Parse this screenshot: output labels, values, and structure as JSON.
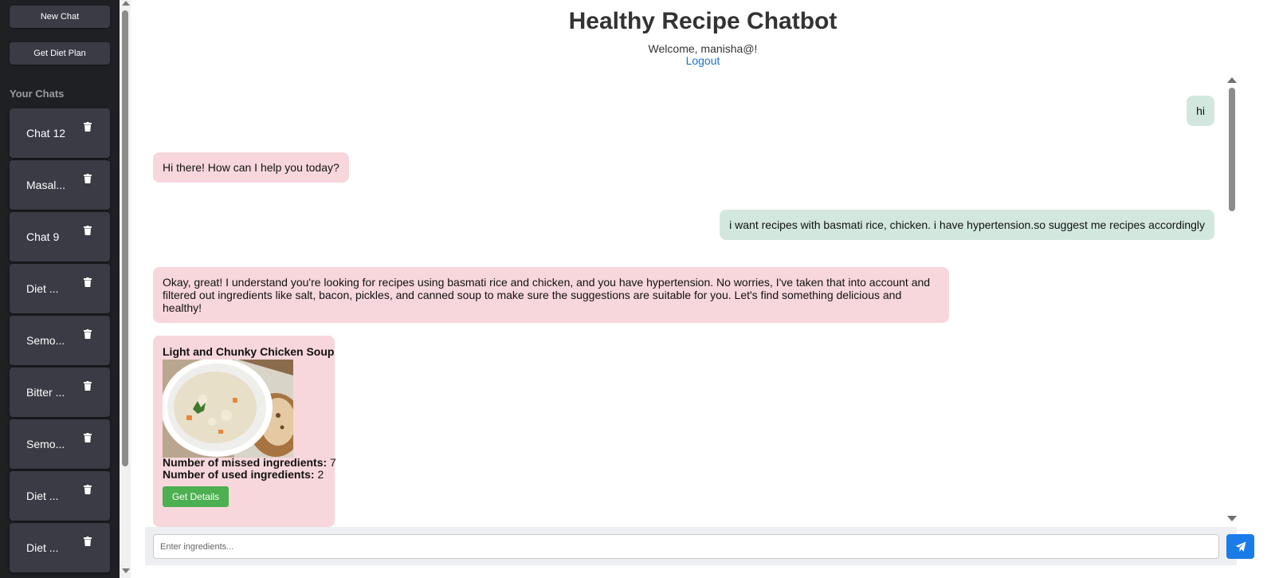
{
  "sidebar": {
    "new_chat_label": "New Chat",
    "diet_plan_label": "Get Diet Plan",
    "section_title": "Your Chats",
    "chats": [
      {
        "label": "Chat 12"
      },
      {
        "label": "Masal..."
      },
      {
        "label": "Chat 9"
      },
      {
        "label": "Diet ..."
      },
      {
        "label": "Semo..."
      },
      {
        "label": "Bitter ..."
      },
      {
        "label": "Semo..."
      },
      {
        "label": "Diet ..."
      },
      {
        "label": "Diet ..."
      }
    ]
  },
  "header": {
    "title": "Healthy Recipe Chatbot",
    "welcome": "Welcome, manisha@!",
    "logout": "Logout"
  },
  "messages": [
    {
      "role": "user",
      "text": "hi"
    },
    {
      "role": "bot",
      "text": "Hi there! How can I help you today?"
    },
    {
      "role": "user",
      "text": "i want recipes with basmati rice, chicken. i have hypertension.so suggest me recipes accordingly"
    },
    {
      "role": "bot",
      "text": "Okay, great! I understand you're looking for recipes using basmati rice and chicken, and you have hypertension. No worries, I've taken that into account and filtered out ingredients like salt, bacon, pickles, and canned soup to make sure the suggestions are suitable for you. Let's find something delicious and healthy!"
    }
  ],
  "recipe": {
    "title": "Light and Chunky Chicken Soup",
    "missed_label": "Number of missed ingredients:",
    "missed_value": "7",
    "used_label": "Number of used ingredients:",
    "used_value": "2",
    "button_label": "Get Details"
  },
  "input": {
    "placeholder": "Enter ingredients...",
    "value": ""
  },
  "icons": {
    "trash": "trash-icon",
    "send": "paper-plane-icon"
  },
  "colors": {
    "sidebar_bg": "#1f2024",
    "chat_item_bg": "#3a3b45",
    "user_bubble": "#d2e8df",
    "bot_bubble": "#f7d7dc",
    "details_button": "#4caf50",
    "send_button": "#1a7ce8",
    "link": "#1a73c9"
  }
}
